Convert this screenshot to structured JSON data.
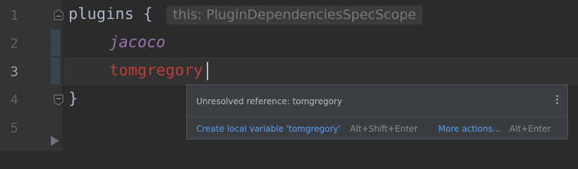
{
  "editor": {
    "line_numbers": [
      "1",
      "2",
      "3",
      "4",
      "5"
    ],
    "current_line_number": "3",
    "lines": {
      "line1_keyword": "plugins",
      "line1_brace": " {",
      "line2_ident": "jacoco",
      "line3_ident": "tomgregory",
      "line4_brace": "}"
    },
    "inlay_hint": "this: PluginDependenciesSpecScope"
  },
  "popup": {
    "message": "Unresolved reference: tomgregory",
    "menu_icon": "more-vertical-icon",
    "actions": [
      {
        "label": "Create local variable 'tomgregory'",
        "shortcut": "Alt+Shift+Enter"
      },
      {
        "label": "More actions...",
        "shortcut": "Alt+Enter"
      }
    ]
  },
  "colors": {
    "background": "#2b2b2b",
    "gutter": "#313335",
    "text": "#a9b7c6",
    "identifier": "#9876aa",
    "error": "#bc3f3c",
    "link": "#589df6"
  }
}
